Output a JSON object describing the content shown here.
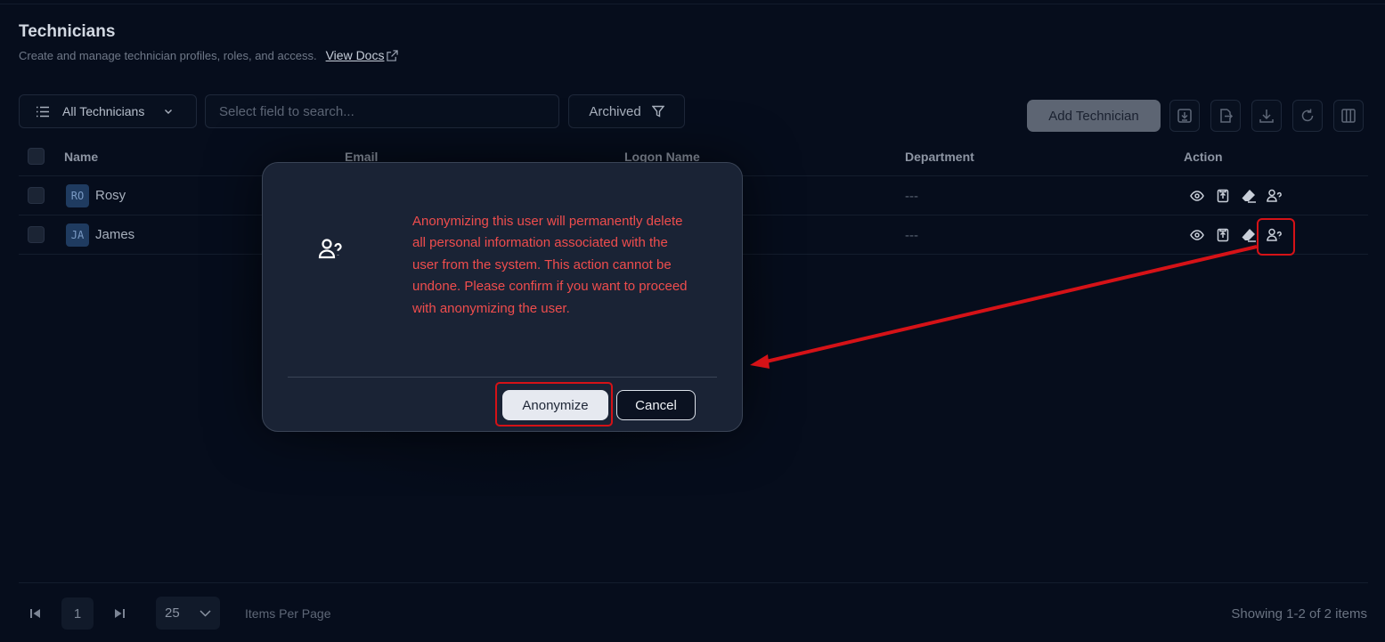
{
  "header": {
    "title": "Technicians",
    "subtitle": "Create and manage technician profiles, roles, and access.",
    "docs_link": "View Docs"
  },
  "toolbar": {
    "filter_label": "All Technicians",
    "search_placeholder": "Select field to search...",
    "archived_label": "Archived",
    "add_label": "Add Technician",
    "tool_icons": [
      "import-icon",
      "export-icon",
      "download-icon",
      "refresh-icon",
      "columns-icon"
    ]
  },
  "table": {
    "columns": [
      "Name",
      "Email",
      "Logon Name",
      "Department",
      "Action"
    ],
    "rows": [
      {
        "initials": "RO",
        "name": "Rosy",
        "department": "---"
      },
      {
        "initials": "JA",
        "name": "James",
        "department": "---"
      }
    ],
    "action_icons": [
      "eye-icon",
      "archive-icon",
      "eraser-icon",
      "anonymize-user-icon"
    ]
  },
  "pagination": {
    "current_page": "1",
    "per_page": "25",
    "per_page_label": "Items Per Page",
    "showing": "Showing 1-2 of 2 items"
  },
  "modal": {
    "message": "Anonymizing this user will permanently delete all personal information associated with the user from the system. This action cannot be undone. Please confirm if you want to proceed with anonymizing the user.",
    "confirm_label": "Anonymize",
    "cancel_label": "Cancel"
  },
  "colors": {
    "background": "#060d1c",
    "modal_bg": "#1a2335",
    "warning_text": "#ef4d4d",
    "annotation": "#d51217"
  }
}
